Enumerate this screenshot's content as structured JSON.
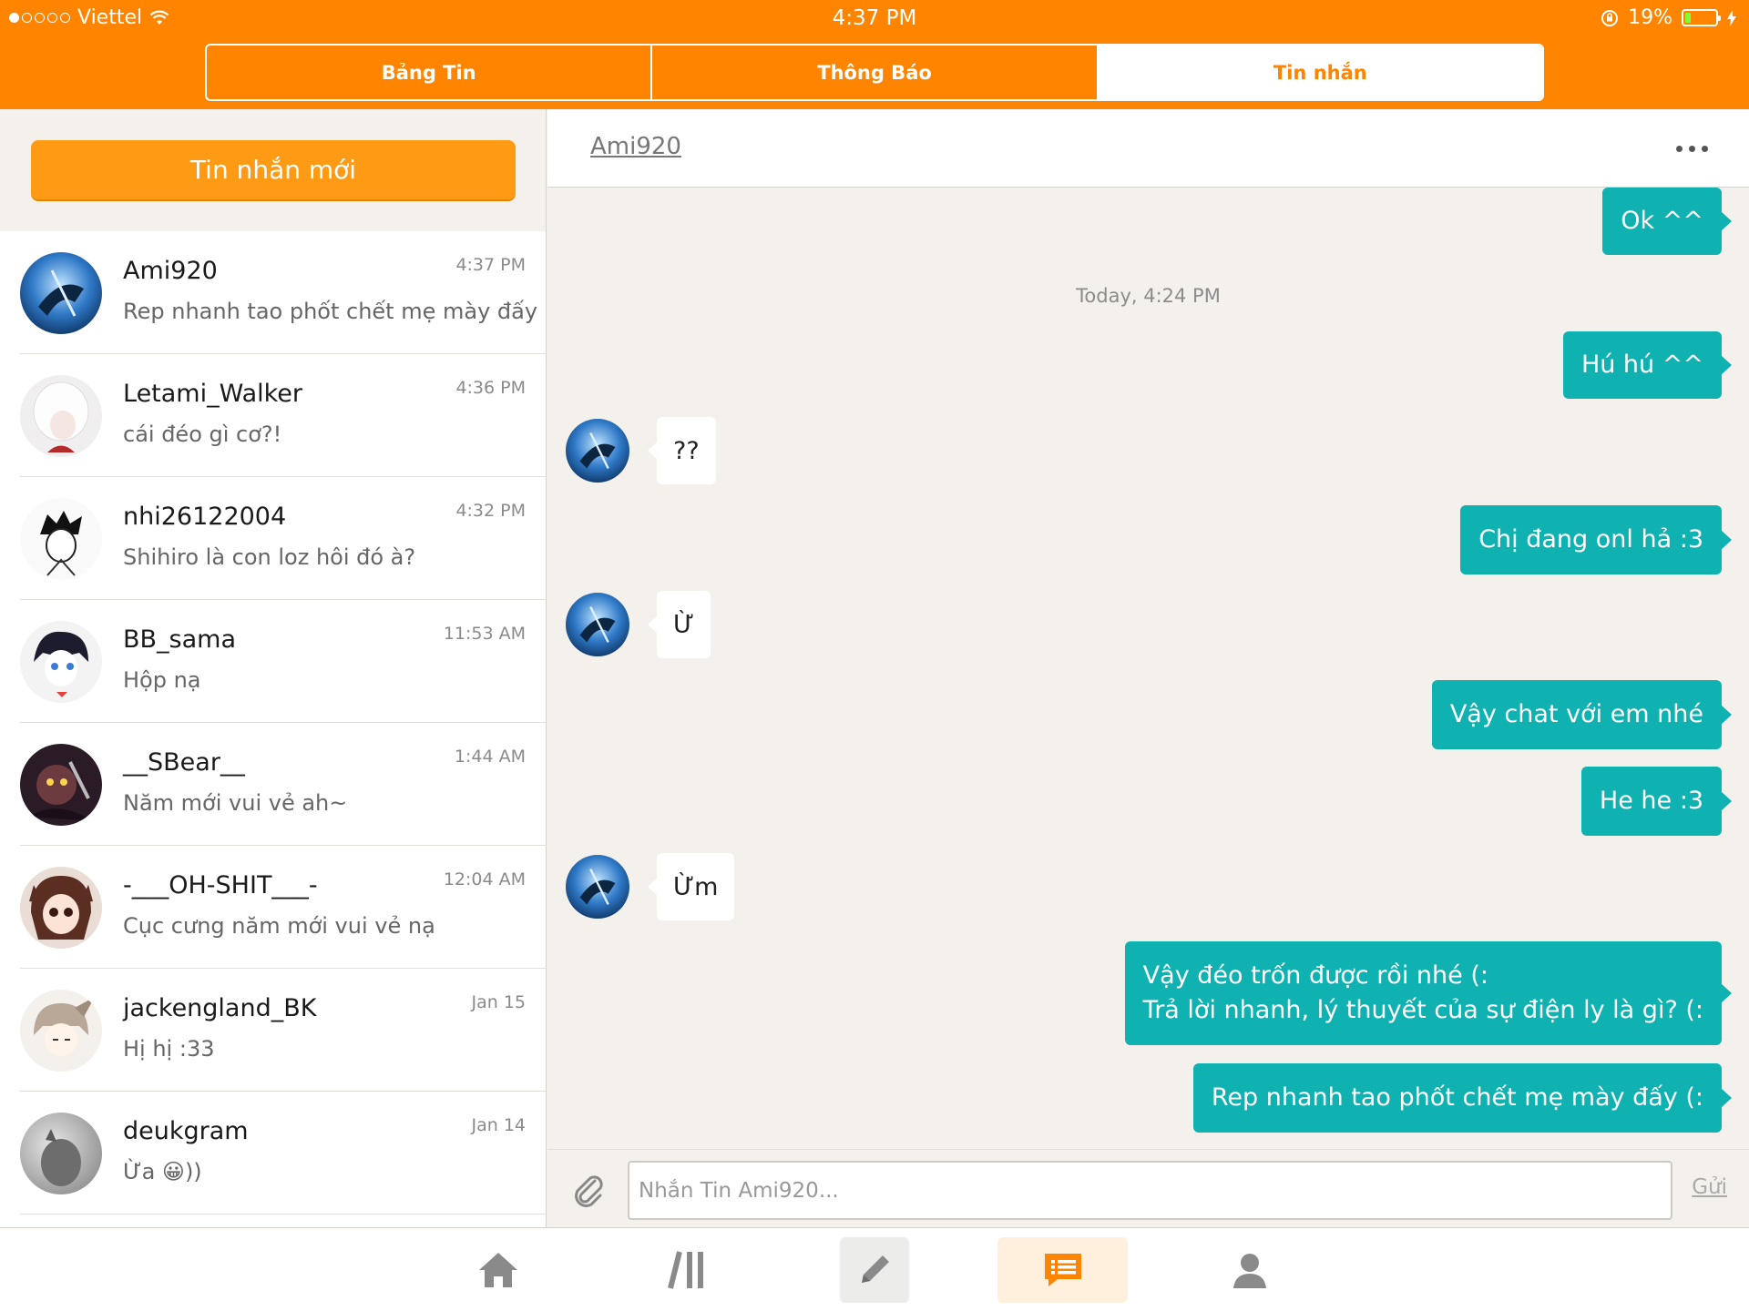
{
  "status_bar": {
    "carrier": "Viettel",
    "time": "4:37 PM",
    "battery": "19%"
  },
  "segments": [
    "Bảng Tin",
    "Thông Báo",
    "Tin nhắn"
  ],
  "left": {
    "new_message_label": "Tin nhắn mới",
    "conversations": [
      {
        "name": "Ami920",
        "preview": "Rep nhanh tao phốt chết mẹ mày đấy (:",
        "time": "4:37 PM"
      },
      {
        "name": "Letami_Walker",
        "preview": "cái đéo gì cơ?!",
        "time": "4:36 PM"
      },
      {
        "name": "nhi26122004",
        "preview": "Shihiro là con loz hôi đó à?",
        "time": "4:32 PM"
      },
      {
        "name": "BB_sama",
        "preview": "Hộp nạ",
        "time": "11:53 AM"
      },
      {
        "name": "__SBear__",
        "preview": "Năm mới vui vẻ ah~",
        "time": "1:44 AM"
      },
      {
        "name": "-___OH-SHIT___-",
        "preview": "Cục cưng năm mới vui vẻ nạ",
        "time": "12:04 AM"
      },
      {
        "name": "jackengland_BK",
        "preview": "Hị hị :33",
        "time": "Jan 15"
      },
      {
        "name": "deukgram",
        "preview": "Ừa 😀))",
        "time": "Jan 14"
      }
    ]
  },
  "chat": {
    "title": "Ami920",
    "timestamp": "Today, 4:24 PM",
    "messages": [
      {
        "dir": "out",
        "text": "Ok ^^"
      },
      {
        "dir": "out",
        "text": "Hú hú ^^"
      },
      {
        "dir": "in",
        "text": "??"
      },
      {
        "dir": "out",
        "text": "Chị đang onl hả :3"
      },
      {
        "dir": "in",
        "text": "Ừ"
      },
      {
        "dir": "out",
        "text": "Vậy chat với em nhé"
      },
      {
        "dir": "out",
        "text": "He he :3"
      },
      {
        "dir": "in",
        "text": "Ừm"
      },
      {
        "dir": "out",
        "text": "Vậy đéo trốn được rồi nhé (:"
      },
      {
        "dir": "out",
        "text": "Trả lời nhanh, lý thuyết của sự điện ly là gì? (:"
      },
      {
        "dir": "out",
        "text": "Rep nhanh tao phốt chết mẹ mày đấy (:"
      }
    ],
    "input_placeholder": "Nhắn Tin Ami920...",
    "send_label": "Gửi"
  },
  "tabbar": {
    "icons": [
      "home-icon",
      "library-icon",
      "pencil-icon",
      "messages-icon",
      "profile-icon"
    ],
    "active": "messages-icon"
  },
  "colors": {
    "brand_orange": "#ff8400",
    "new_button": "#ff9a14",
    "bubble_out": "#0fb1b1",
    "background": "#f4f1ec"
  }
}
